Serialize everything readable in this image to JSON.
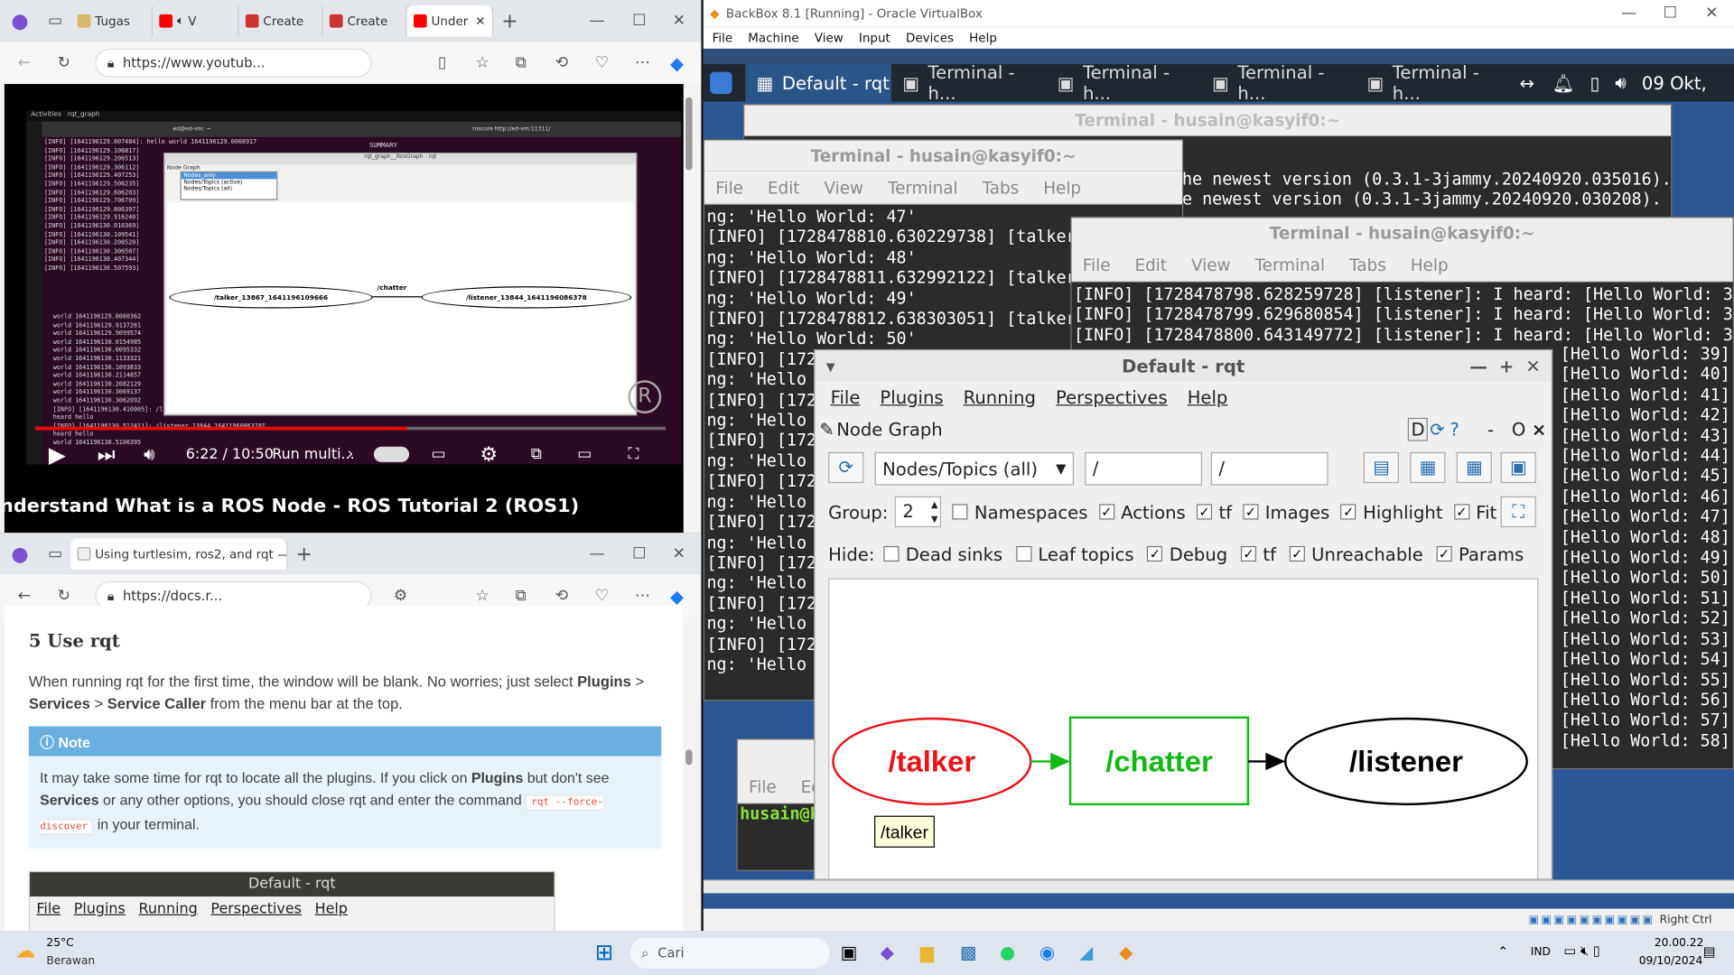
{
  "browser1": {
    "tabs": [
      "Tugas",
      "V",
      "Create",
      "Create",
      "Under"
    ],
    "url": "https://www.youtub...",
    "video": {
      "time": "6:22 / 10:50",
      "chapter": "Run multi...",
      "title": "nderstand What is a ROS Node - ROS Tutorial 2 (ROS1)",
      "progress": 0.59,
      "inner_menu": [
        "Activities",
        "rqt_graph"
      ],
      "inner_host": "ed@ed-vm: ~",
      "inner_url": "roscore http://ed-vm:11311/",
      "inner_rqt_title": "rqt_graph__RosGraph - rqt",
      "inner_node_graph": "Node Graph",
      "inner_dropdown": [
        "Nodes_only",
        "Nodes/Topics (active)",
        "Nodes/Topics (all)"
      ],
      "inner_summary": "SUMMARY",
      "inner_nodes": [
        "/talker_13867_1641196109666",
        "/chatter",
        "/listener_13844_1641196086378"
      ],
      "inner_log": [
        "[INFO] [1641196129.007484]: hello world 1641196129.0068917",
        "[INFO] [1641196129.106817]",
        "[INFO] [1641196129.206513]",
        "[INFO] [1641196129.306112]",
        "[INFO] [1641196129.407253]",
        "[INFO] [1641196129.506235]",
        "[INFO] [1641196129.606203]",
        "[INFO] [1641196129.706709]",
        "[INFO] [1641196129.806397]",
        "[INFO] [1641196129.916240]",
        "[INFO] [1641196130.010369]",
        "[INFO] [1641196130.109541]",
        "[INFO] [1641196130.208520]",
        "[INFO] [1641196130.306507]",
        "[INFO] [1641196130.407344]",
        "[INFO] [1641196130.507593]"
      ],
      "inner_log2": [
        "world 1641196129.8060362",
        "world 1641196129.9137261",
        "world 1641196129.9099574",
        "world 1641196130.0154985",
        "world 1641196130.0095332",
        "world 1641196130.1133321",
        "world 1641196130.1093833",
        "world 1641196130.2114857",
        "world 1641196130.2082129",
        "world 1641196130.3069137",
        "world 1641196130.3062092",
        "[INFO] [1641196130.410005]: /listener_13844_1641196086378I heard hello",
        "[INFO] [1641196130.512411]: /listener_13844_1641196086378I heard hello",
        "world 1641196130.5106395"
      ]
    }
  },
  "browser2": {
    "tab": "Using turtlesim, ros2, and rqt — R",
    "url": "https://docs.r...",
    "heading": "5 Use rqt",
    "para_parts": [
      "When running rqt for the first time, the window will be blank. No worries; just select ",
      "Plugins",
      " > ",
      "Services",
      " > ",
      "Service Caller",
      " from the menu bar at the top."
    ],
    "note_title": "Note",
    "note_parts": [
      "It may take some time for rqt to locate all the plugins. If you click on ",
      "Plugins",
      " but don't see ",
      "Services",
      " or any other options, you should close rqt and enter the command ",
      "rqt --force-discover",
      " in your terminal."
    ],
    "img_title": "Default - rqt",
    "img_menu": [
      "File",
      "Plugins",
      "Running",
      "Perspectives",
      "Help"
    ]
  },
  "vbox": {
    "title": "BackBox 8.1 [Running] - Oracle VirtualBox",
    "menu": [
      "File",
      "Machine",
      "View",
      "Input",
      "Devices",
      "Help"
    ],
    "status_right": "Right Ctrl",
    "panel": {
      "tasks": [
        "Default - rqt",
        "Terminal - h...",
        "Terminal - h...",
        "Terminal - h...",
        "Terminal - h..."
      ],
      "clock": "09 Okt,"
    },
    "term_back": {
      "title": "Terminal - husain@kasyif0:~",
      "lines": [
        "he newest version (0.3.1-3jammy.20240920.035016).",
        "e newest version (0.3.1-3jammy.20240920.030208)."
      ]
    },
    "term_talker": {
      "title": "Terminal - husain@kasyif0:~",
      "menu": [
        "File",
        "Edit",
        "View",
        "Terminal",
        "Tabs",
        "Help"
      ],
      "lines": [
        "ng: 'Hello World: 47'",
        "[INFO] [1728478810.630229738] [talker]",
        "ng: 'Hello World: 48'",
        "[INFO] [1728478811.632992122] [talker]",
        "ng: 'Hello World: 49'",
        "[INFO] [1728478812.638303051] [talker]",
        "ng: 'Hello World: 50'",
        "[INFO] [1728",
        "ng: 'Hello W",
        "[INFO] [1728",
        "ng: 'Hello W",
        "[INFO] [1728",
        "ng: 'Hello W",
        "[INFO] [1728",
        "ng: 'Hello W",
        "[INFO] [1728",
        "ng: 'Hello W",
        "[INFO] [1728",
        "ng: 'Hello W",
        "[INFO] [1728",
        "ng: 'Hello W",
        "[INFO] [1728",
        "ng: 'Hello W"
      ]
    },
    "term_listener": {
      "title": "Terminal - husain@kasyif0:~",
      "menu": [
        "File",
        "Edit",
        "View",
        "Terminal",
        "Tabs",
        "Help"
      ],
      "lines": [
        "[INFO] [1728478798.628259728] [listener]: I heard: [Hello World: 36]",
        "[INFO] [1728478799.629680854] [listener]: I heard: [Hello World: 37]",
        "[INFO] [1728478800.643149772] [listener]: I heard: [Hello World: 38]"
      ],
      "right_lines": [
        "[Hello World: 39]",
        "[Hello World: 40]",
        "[Hello World: 41]",
        "[Hello World: 42]",
        "[Hello World: 43]",
        "[Hello World: 44]",
        "[Hello World: 45]",
        "[Hello World: 46]",
        "[Hello World: 47]",
        "[Hello World: 48]",
        "[Hello World: 49]",
        "[Hello World: 50]",
        "[Hello World: 51]",
        "[Hello World: 52]",
        "[Hello World: 53]",
        "[Hello World: 54]",
        "[Hello World: 55]",
        "[Hello World: 56]",
        "[Hello World: 57]",
        "[Hello World: 58]"
      ]
    },
    "term_small": {
      "menu": [
        "File",
        "Ed"
      ],
      "prompt": "husain@k"
    },
    "rqt": {
      "title": "Default - rqt",
      "menu": [
        "File",
        "Plugins",
        "Running",
        "Perspectives",
        "Help"
      ],
      "plugin": "Node Graph",
      "dock_btns": [
        "D",
        "-",
        "O",
        "×"
      ],
      "combo": "Nodes/Topics (all)",
      "filter1": "/",
      "filter2": "/",
      "group_label": "Group:",
      "group_value": "2",
      "opts": [
        {
          "label": "Namespaces",
          "checked": false
        },
        {
          "label": "Actions",
          "checked": true
        },
        {
          "label": "tf",
          "checked": true
        },
        {
          "label": "Images",
          "checked": true
        },
        {
          "label": "Highlight",
          "checked": true
        },
        {
          "label": "Fit",
          "checked": true
        }
      ],
      "hide_label": "Hide:",
      "hide": [
        {
          "label": "Dead sinks",
          "checked": false
        },
        {
          "label": "Leaf topics",
          "checked": false
        },
        {
          "label": "Debug",
          "checked": true
        },
        {
          "label": "tf",
          "checked": true
        },
        {
          "label": "Unreachable",
          "checked": true
        },
        {
          "label": "Params",
          "checked": true
        }
      ],
      "nodes": {
        "talker": "/talker",
        "chatter": "/chatter",
        "listener": "/listener"
      },
      "tooltip": "/talker",
      "colors": {
        "talker": "#e8141a",
        "chatter": "#14b814",
        "listener": "#000000"
      }
    }
  },
  "taskbar": {
    "temp": "25°C",
    "weather": "Berawan",
    "search": "Cari",
    "lang": "IND",
    "time": "20.00.22",
    "date": "09/10/2024"
  }
}
